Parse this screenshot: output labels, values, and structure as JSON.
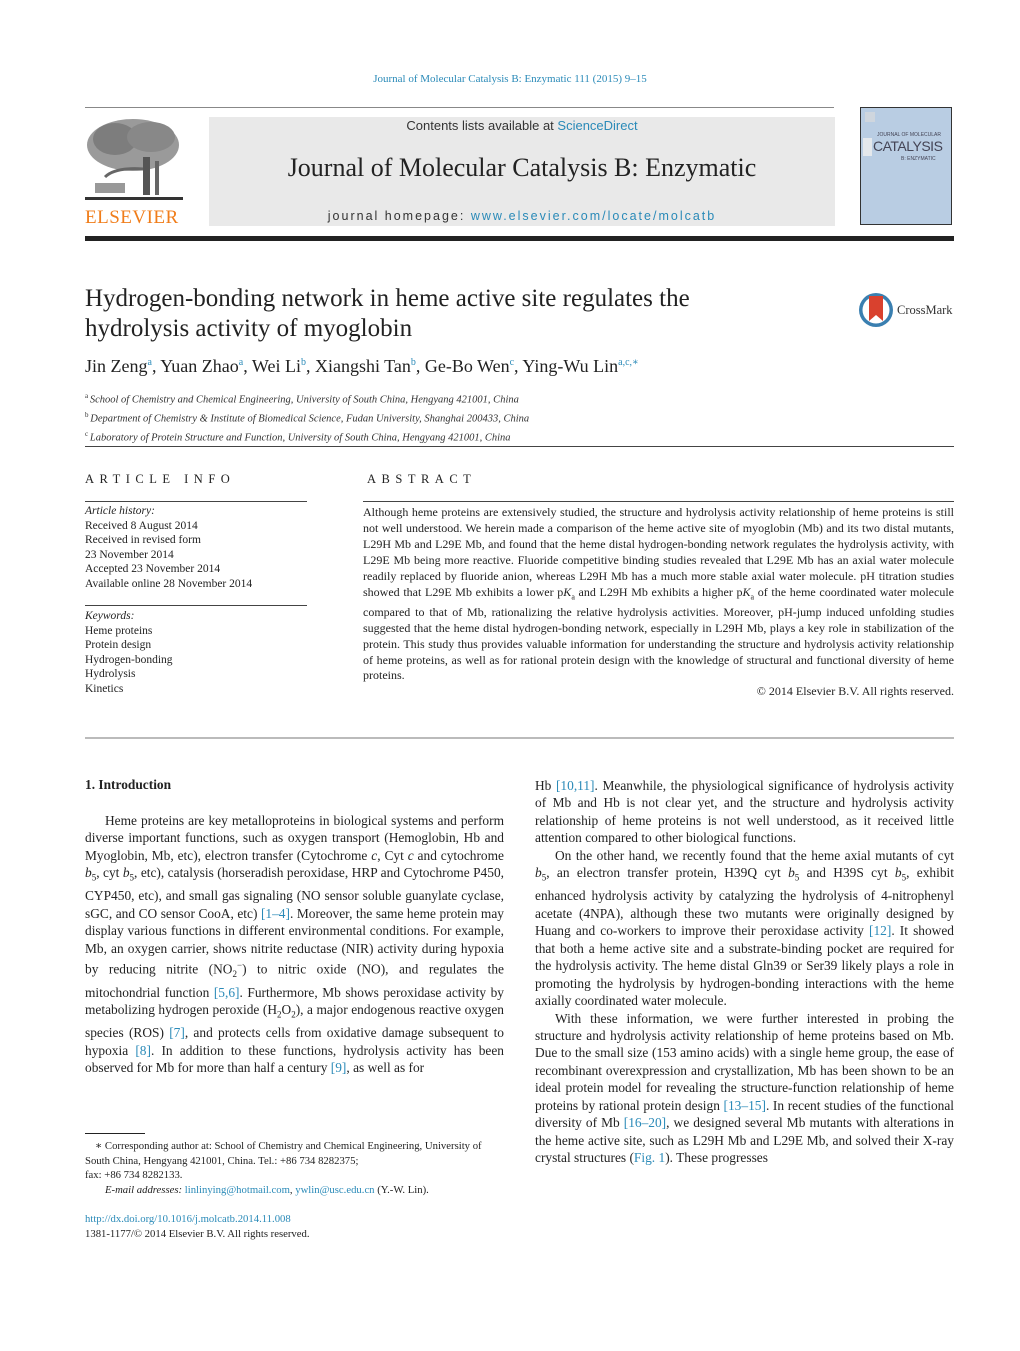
{
  "header": {
    "running_head": "Journal of Molecular Catalysis B: Enzymatic 111 (2015) 9–15",
    "contents_prefix": "Contents lists available at ",
    "contents_link": "ScienceDirect",
    "journal_title": "Journal of Molecular Catalysis B: Enzymatic",
    "homepage_prefix": "journal homepage: ",
    "homepage_link": "www.elsevier.com/locate/molcatb",
    "publisher_logo": "ELSEVIER",
    "cover_title": "CATALYSIS",
    "cover_super": "JOURNAL OF MOLECULAR",
    "cover_sub": "B: ENZYMATIC",
    "brand_orange": "#f07d1a",
    "link_color": "#2a8ab8"
  },
  "article": {
    "title_line1": "Hydrogen-bonding network in heme active site regulates the",
    "title_line2": "hydrolysis activity of myoglobin",
    "crossmark": "CrossMark",
    "authors": [
      {
        "name": "Jin Zeng",
        "sup": "a"
      },
      {
        "name": "Yuan Zhao",
        "sup": "a"
      },
      {
        "name": "Wei Li",
        "sup": "b"
      },
      {
        "name": "Xiangshi Tan",
        "sup": "b"
      },
      {
        "name": "Ge-Bo Wen",
        "sup": "c"
      },
      {
        "name": "Ying-Wu Lin",
        "sup": "a,c,∗"
      }
    ],
    "affiliations": [
      {
        "sup": "a",
        "text": "School of Chemistry and Chemical Engineering, University of South China, Hengyang 421001, China"
      },
      {
        "sup": "b",
        "text": "Department of Chemistry & Institute of Biomedical Science, Fudan University, Shanghai 200433, China"
      },
      {
        "sup": "c",
        "text": "Laboratory of Protein Structure and Function, University of South China, Hengyang 421001, China"
      }
    ]
  },
  "article_info": {
    "heading": "ARTICLE INFO",
    "history_label": "Article history:",
    "history": [
      "Received 8 August 2014",
      "Received in revised form",
      "23 November 2014",
      "Accepted 23 November 2014",
      "Available online 28 November 2014"
    ],
    "keywords_label": "Keywords:",
    "keywords": [
      "Heme proteins",
      "Protein design",
      "Hydrogen-bonding",
      "Hydrolysis",
      "Kinetics"
    ]
  },
  "abstract": {
    "heading": "ABSTRACT",
    "part1": "Although heme proteins are extensively studied, the structure and hydrolysis activity relationship of heme proteins is still not well understood. We herein made a comparison of the heme active site of myoglobin (Mb) and its two distal mutants, L29H Mb and L29E Mb, and found that the heme distal hydrogen-bonding network regulates the hydrolysis activity, with L29E Mb being more reactive. Fluoride competitive binding studies revealed that L29E Mb has an axial water molecule readily replaced by fluoride anion, whereas L29H Mb has a much more stable axial water molecule. pH titration studies showed that L29E Mb exhibits a lower p",
    "part2": " and L29H Mb exhibits a higher p",
    "part3": " of the heme coordinated water molecule compared to that of Mb, rationalizing the relative hydrolysis activities. Moreover, pH-jump induced unfolding studies suggested that the heme distal hydrogen-bonding network, especially in L29H Mb, plays a key role in stabilization of the protein. This study thus provides valuable information for understanding the structure and hydrolysis activity relationship of heme proteins, as well as for rational protein design with the knowledge of structural and functional diversity of heme proteins.",
    "k": "K",
    "a": "a",
    "copyright": "© 2014 Elsevier B.V. All rights reserved."
  },
  "intro": {
    "heading": "1.  Introduction",
    "left_p1": [
      "Heme proteins are key metalloproteins in biological systems and perform diverse important functions, such as oxygen transport (Hemoglobin, Hb and Myoglobin, Mb, etc), electron transfer (Cytochrome ",
      "c",
      ", Cyt ",
      "c",
      " and cytochrome ",
      "b",
      "5",
      ", cyt ",
      "b",
      "5",
      ", etc), catalysis (horseradish peroxidase, HRP and Cytochrome P450, CYP450, etc), and small gas signaling (NO sensor soluble guanylate cyclase, sGC, and CO sensor CooA, etc) ",
      "[1–4]",
      ". Moreover, the same heme protein may display various functions in different environmental conditions. For example, Mb, an oxygen carrier, shows nitrite reductase (NIR) activity during hypoxia by reducing nitrite (NO",
      "2",
      "−",
      ") to nitric oxide (NO), and regulates the mitochondrial function ",
      "[5,6]",
      ". Furthermore, Mb shows peroxidase activity by metabolizing hydrogen peroxide (H",
      "2",
      "O",
      "2",
      "), a major endogenous reactive oxygen species (ROS) ",
      "[7]",
      ", and protects cells from oxidative damage subsequent to hypoxia ",
      "[8]",
      ". In addition to these functions, hydrolysis activity has been observed for Mb for more than half a century ",
      "[9]",
      ", as well as for"
    ],
    "right_p1": [
      "Hb ",
      "[10,11]",
      ". Meanwhile, the physiological significance of hydrolysis activity of Mb and Hb is not clear yet, and the structure and hydrolysis activity relationship of heme proteins is not well understood, as it received little attention compared to other biological functions."
    ],
    "right_p2": [
      "On the other hand, we recently found that the heme axial mutants of cyt ",
      "b",
      "5",
      ", an electron transfer protein, H39Q cyt ",
      "b",
      "5",
      " and H39S cyt ",
      "b",
      "5",
      ", exhibit enhanced hydrolysis activity by catalyzing the hydrolysis of 4-nitrophenyl acetate (4NPA), although these two mutants were originally designed by Huang and co-workers to improve their peroxidase activity ",
      "[12]",
      ". It showed that both a heme active site and a substrate-binding pocket are required for the hydrolysis activity. The heme distal Gln39 or Ser39 likely plays a role in promoting the hydrolysis by hydrogen-bonding interactions with the heme axially coordinated water molecule."
    ],
    "right_p3": [
      "With these information, we were further interested in probing the structure and hydrolysis activity relationship of heme proteins based on Mb. Due to the small size (153 amino acids) with a single heme group, the ease of recombinant overexpression and crystallization, Mb has been shown to be an ideal protein model for revealing the structure-function relationship of heme proteins by rational protein design ",
      "[13–15]",
      ". In recent studies of the functional diversity of Mb ",
      "[16–20]",
      ", we designed several Mb mutants with alterations in the heme active site, such as L29H Mb and L29E Mb, and solved their X-ray crystal structures (",
      "Fig. 1",
      "). These progresses"
    ]
  },
  "footnote": {
    "star_text": "∗  Corresponding author at: School of Chemistry and Chemical Engineering, University of South China, Hengyang 421001, China. Tel.: +86 734 8282375;",
    "fax": "fax: +86 734 8282133.",
    "email_label": "E-mail addresses: ",
    "email1": "linlinying@hotmail.com",
    "email_sep": ", ",
    "email2": "ywlin@usc.edu.cn",
    "email_suffix": " (Y.-W. Lin).",
    "doi": "http://dx.doi.org/10.1016/j.molcatb.2014.11.008",
    "issn": "1381-1177/© 2014 Elsevier B.V. All rights reserved."
  }
}
